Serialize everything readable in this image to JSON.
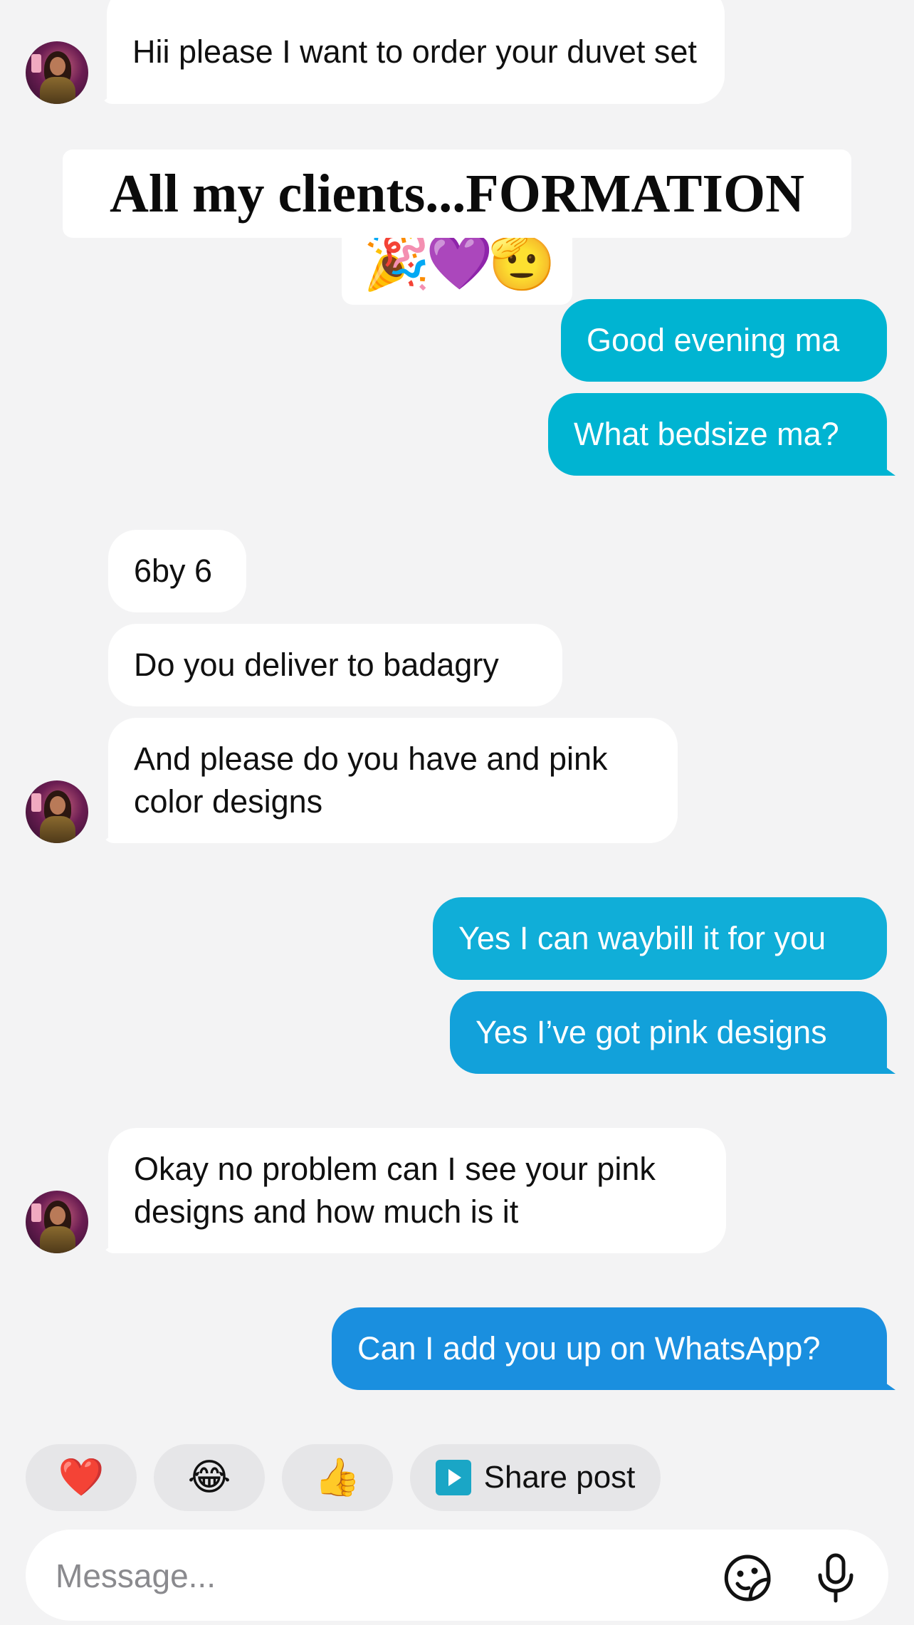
{
  "messages": {
    "m1": "Hii please I want to order your duvet set",
    "m2": "Good evening ma",
    "m3": "What bedsize ma?",
    "m4": "6by 6",
    "m5": "Do you deliver to badagry",
    "m6": "And please do you have and pink color designs",
    "m7": "Yes I can waybill it for you",
    "m8": "Yes I’ve got pink designs",
    "m9": "Okay no problem can I see your pink designs and how much is it",
    "m10": "Can I add you up on WhatsApp?"
  },
  "overlay": {
    "caption": "All my clients...FORMATION",
    "emojis": [
      "🎉",
      "💜",
      "🫡"
    ]
  },
  "quick_replies": {
    "heart": "❤️",
    "laugh": "😂",
    "thumbs": "👍",
    "share_label": "Share post"
  },
  "composer": {
    "placeholder": "Message..."
  },
  "colors": {
    "outgoing_teal": "#00b4d2",
    "outgoing_cyan": "#10a9d9",
    "outgoing_blue": "#1a8fdf",
    "incoming": "#ffffff",
    "background": "#f3f3f4"
  }
}
